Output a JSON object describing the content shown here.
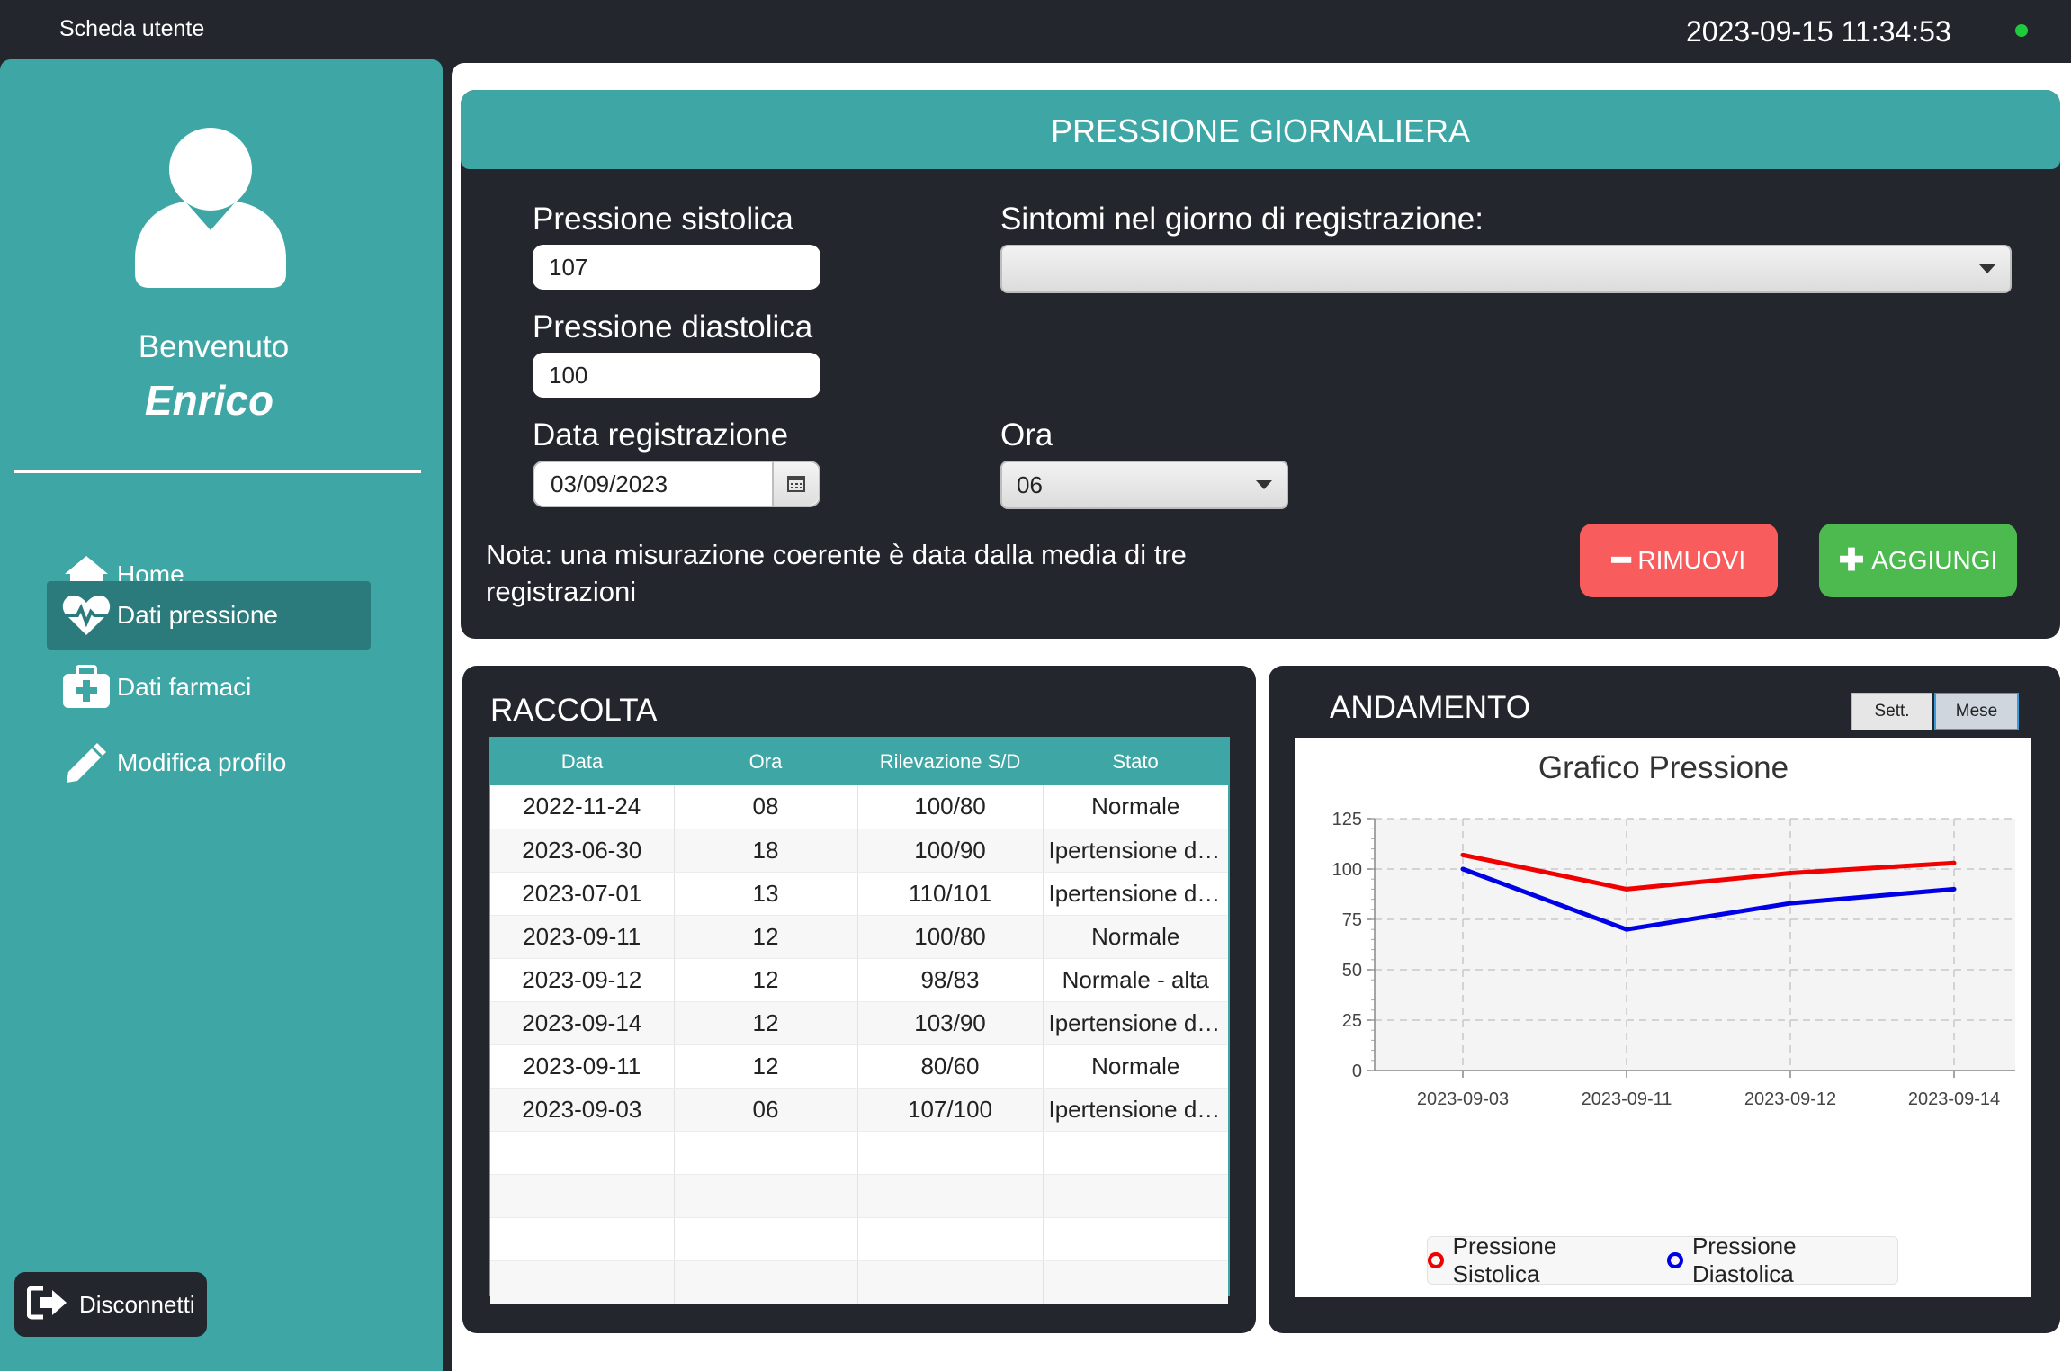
{
  "window": {
    "title": "Scheda utente",
    "datetime": "2023-09-15 11:34:53"
  },
  "sidebar": {
    "welcome": "Benvenuto",
    "username": "Enrico",
    "items": [
      {
        "label": "Home",
        "icon": "home-icon"
      },
      {
        "label": "Dati pressione",
        "icon": "heart-pulse-icon",
        "active": true
      },
      {
        "label": "Dati farmaci",
        "icon": "first-aid-icon"
      },
      {
        "label": "Modifica profilo",
        "icon": "pencil-icon"
      }
    ],
    "logout_label": "Disconnetti"
  },
  "form": {
    "header": "PRESSIONE GIORNALIERA",
    "systolic_label": "Pressione sistolica",
    "systolic_value": "107",
    "diastolic_label": "Pressione diastolica",
    "diastolic_value": "100",
    "date_label": "Data registrazione",
    "date_value": "03/09/2023",
    "symptoms_label": "Sintomi nel giorno di registrazione:",
    "symptoms_value": "",
    "hour_label": "Ora",
    "hour_value": "06",
    "note": "Nota: una misurazione coerente è data dalla media di tre registrazioni",
    "remove_label": "RIMUOVI",
    "add_label": "AGGIUNGI",
    "remove_color": "#f85c5c",
    "add_color": "#4cba4f"
  },
  "raccolta": {
    "title": "RACCOLTA",
    "columns": [
      "Data",
      "Ora",
      "Rilevazione S/D",
      "Stato"
    ],
    "rows": [
      [
        "2022-11-24",
        "08",
        "100/80",
        "Normale"
      ],
      [
        "2023-06-30",
        "18",
        "100/90",
        "Ipertensione di ..."
      ],
      [
        "2023-07-01",
        "13",
        "110/101",
        "Ipertensione di ..."
      ],
      [
        "2023-09-11",
        "12",
        "100/80",
        "Normale"
      ],
      [
        "2023-09-12",
        "12",
        "98/83",
        "Normale - alta"
      ],
      [
        "2023-09-14",
        "12",
        "103/90",
        "Ipertensione di ..."
      ],
      [
        "2023-09-11",
        "12",
        "80/60",
        "Normale"
      ],
      [
        "2023-09-03",
        "06",
        "107/100",
        "Ipertensione di ..."
      ],
      [
        "",
        "",
        "",
        ""
      ],
      [
        "",
        "",
        "",
        ""
      ],
      [
        "",
        "",
        "",
        ""
      ],
      [
        "",
        "",
        "",
        ""
      ]
    ]
  },
  "andamento": {
    "title": "ANDAMENTO",
    "toggle_week": "Sett.",
    "toggle_month": "Mese",
    "active_toggle": "Mese"
  },
  "chart_data": {
    "type": "line",
    "title": "Grafico Pressione",
    "categories": [
      "2023-09-03",
      "2023-09-11",
      "2023-09-12",
      "2023-09-14"
    ],
    "series": [
      {
        "name": "Pressione Sistolica",
        "values": [
          107,
          90,
          98,
          103
        ],
        "color": "#f00000"
      },
      {
        "name": "Pressione Diastolica",
        "values": [
          100,
          70,
          83,
          90
        ],
        "color": "#0000e6"
      }
    ],
    "ylim": [
      0,
      125
    ],
    "yticks": [
      0,
      25,
      50,
      75,
      100,
      125
    ],
    "grid": true,
    "legend": "bottom"
  }
}
